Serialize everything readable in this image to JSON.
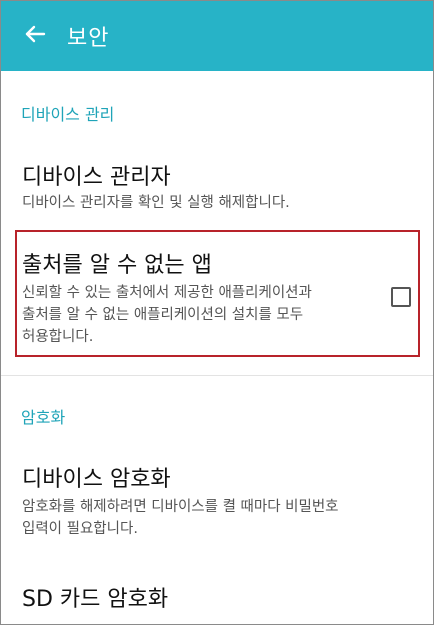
{
  "appbar": {
    "title": "보안",
    "back_icon": "arrow-left-icon",
    "background_color": "#27b3c7"
  },
  "sections": {
    "device_admin": {
      "header": "디바이스 관리",
      "device_admins": {
        "title": "디바이스 관리자",
        "summary": "디바이스 관리자를 확인 및 실행 해제합니다."
      },
      "unknown_sources": {
        "title": "출처를 알 수 없는 앱",
        "summary_line1": "신뢰할 수 있는 출처에서 제공한 애플리케이션과",
        "summary_line2": "출처를 알 수 없는 애플리케이션의 설치를 모두",
        "summary_line3": "허용합니다.",
        "checked": false
      }
    },
    "encryption": {
      "header": "암호화",
      "device_encryption": {
        "title": "디바이스 암호화",
        "summary_line1": "암호화를 해제하려면 디바이스를 켤 때마다 비밀번호",
        "summary_line2": "입력이 필요합니다."
      },
      "sd_encryption": {
        "title": "SD 카드 암호화"
      }
    }
  },
  "colors": {
    "accent": "#1fa4b8",
    "highlight_border": "#b8232a"
  }
}
